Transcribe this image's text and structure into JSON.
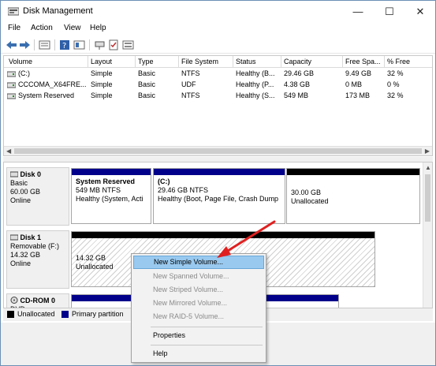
{
  "window": {
    "title": "Disk Management"
  },
  "window_controls": {
    "minimize": "—",
    "maximize": "☐",
    "close": "✕"
  },
  "menu": [
    "File",
    "Action",
    "View",
    "Help"
  ],
  "volume_list": {
    "columns": [
      "Volume",
      "Layout",
      "Type",
      "File System",
      "Status",
      "Capacity",
      "Free Spa...",
      "% Free"
    ],
    "rows": [
      [
        "(C:)",
        "Simple",
        "Basic",
        "NTFS",
        "Healthy (B...",
        "29.46 GB",
        "9.49 GB",
        "32 %"
      ],
      [
        "CCCOMA_X64FRE...",
        "Simple",
        "Basic",
        "UDF",
        "Healthy (P...",
        "4.38 GB",
        "0 MB",
        "0 %"
      ],
      [
        "System Reserved",
        "Simple",
        "Basic",
        "NTFS",
        "Healthy (S...",
        "549 MB",
        "173 MB",
        "32 %"
      ]
    ]
  },
  "disks": [
    {
      "name": "Disk 0",
      "type": "Basic",
      "size": "60.00 GB",
      "status": "Online",
      "partitions": [
        {
          "name": "System Reserved",
          "detail": "549 MB NTFS",
          "status": "Healthy (System, Acti",
          "kind": "primary"
        },
        {
          "name": "(C:)",
          "detail": "29.46 GB NTFS",
          "status": "Healthy (Boot, Page File, Crash Dump",
          "kind": "primary"
        },
        {
          "name": "",
          "detail": "30.00 GB",
          "status": "Unallocated",
          "kind": "unallocated"
        }
      ]
    },
    {
      "name": "Disk 1",
      "type": "Removable (F:)",
      "size": "14.32 GB",
      "status": "Online",
      "partitions": [
        {
          "name": "",
          "detail": "14.32 GB",
          "status": "Unallocated",
          "kind": "unallocated"
        }
      ]
    },
    {
      "name": "CD-ROM 0",
      "type": "DVD",
      "size": "",
      "status": "",
      "partitions": [
        {
          "name": "",
          "detail": "",
          "status": "",
          "kind": "primary"
        }
      ]
    }
  ],
  "legend": [
    {
      "label": "Unallocated",
      "color": "#000000"
    },
    {
      "label": "Primary partition",
      "color": "#00008b"
    }
  ],
  "context_menu": {
    "items": [
      {
        "label": "New Simple Volume...",
        "enabled": true,
        "highlighted": true
      },
      {
        "label": "New Spanned Volume...",
        "enabled": false
      },
      {
        "label": "New Striped Volume...",
        "enabled": false
      },
      {
        "label": "New Mirrored Volume...",
        "enabled": false
      },
      {
        "label": "New RAID-5 Volume...",
        "enabled": false
      },
      {
        "label": "Properties",
        "enabled": true
      },
      {
        "label": "Help",
        "enabled": true
      }
    ]
  },
  "colors": {
    "primary": "#00008b",
    "unallocated": "#000000",
    "highlight": "#99c9ef",
    "annotation_arrow": "#e02020"
  }
}
